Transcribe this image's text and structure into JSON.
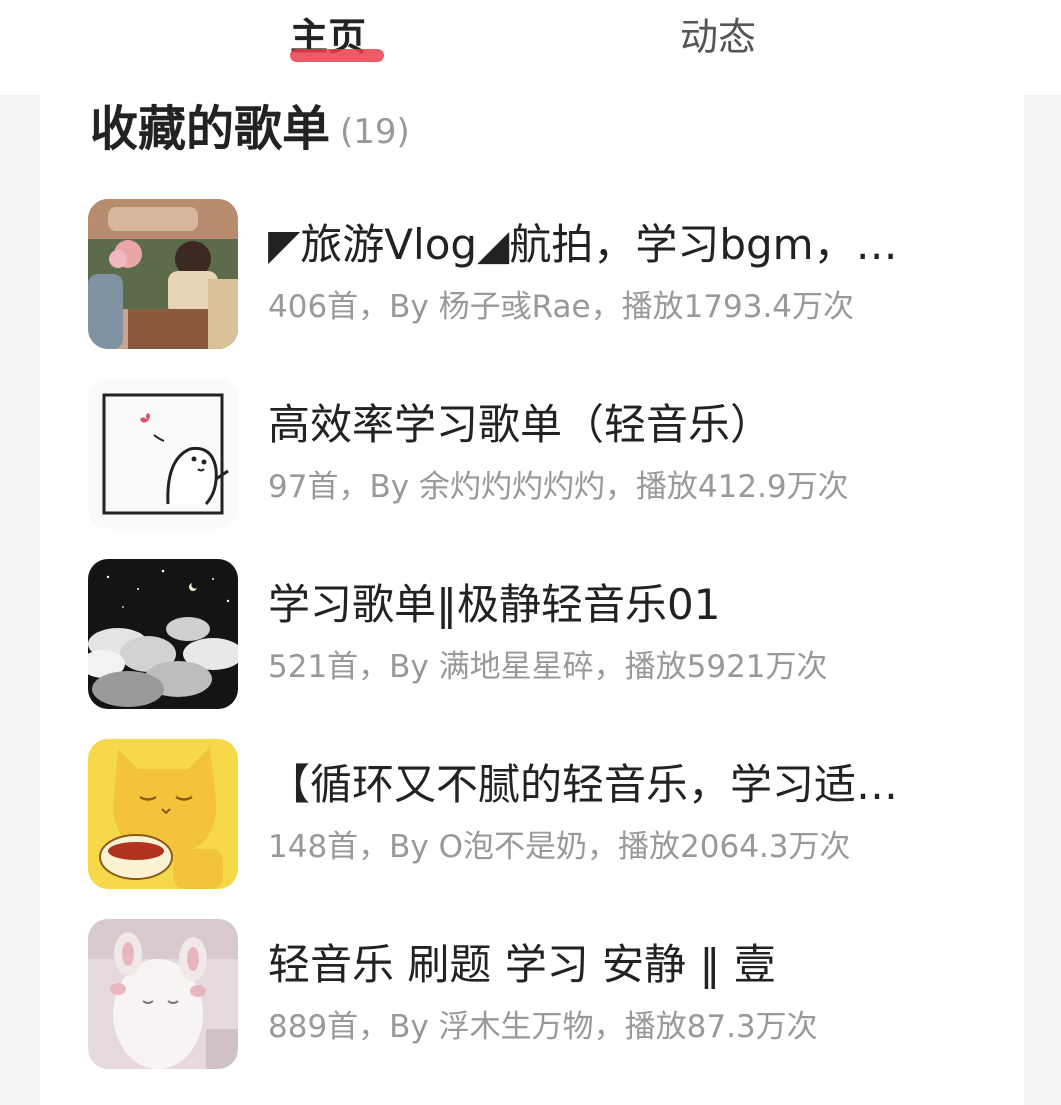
{
  "tabs": {
    "home": "主页",
    "feed": "动态"
  },
  "section": {
    "title": "收藏的歌单",
    "count": "(19)"
  },
  "playlists": [
    {
      "title": "◤旅游Vlog◢航拍，学习bgm，…",
      "meta": "406首，By 杨子彧Rae，播放1793.4万次"
    },
    {
      "title": "高效率学习歌单（轻音乐）",
      "meta": "97首，By 余灼灼灼灼灼，播放412.9万次"
    },
    {
      "title": "学习歌单‖极静轻音乐01",
      "meta": "521首，By 满地星星碎，播放5921万次"
    },
    {
      "title": "【循环又不腻的轻音乐，学习适…",
      "meta": "148首，By O泡不是奶，播放2064.3万次"
    },
    {
      "title": "轻音乐 刷题 学习 安静 ‖ 壹",
      "meta": "889首，By 浮木生万物，播放87.3万次"
    }
  ]
}
